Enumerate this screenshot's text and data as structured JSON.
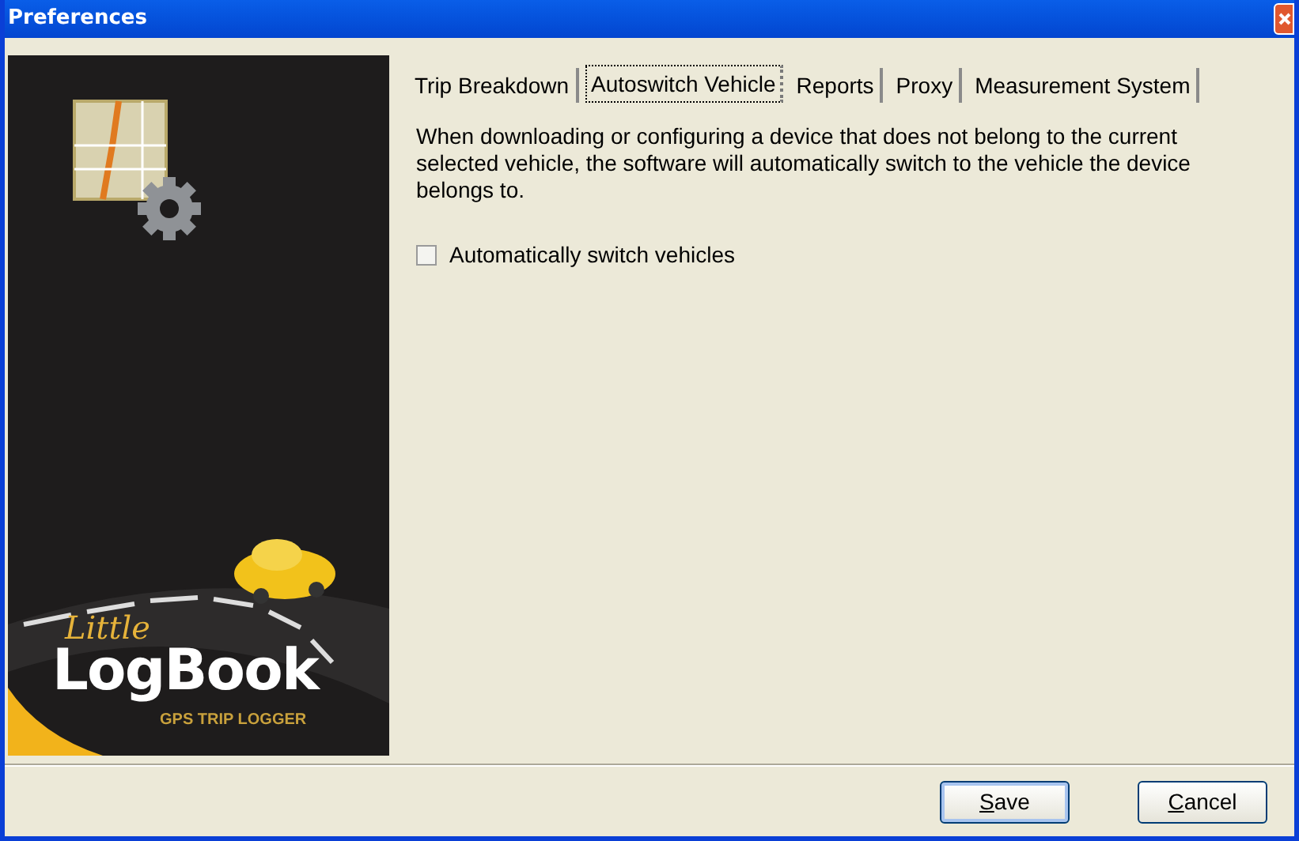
{
  "window": {
    "title": "Preferences"
  },
  "sidebar": {
    "logo_script": "Little",
    "logo_title": "LogBook",
    "logo_subtitle": "GPS TRIP LOGGER"
  },
  "tabs": [
    {
      "label": "Trip Breakdown",
      "selected": false
    },
    {
      "label": "Autoswitch Vehicle",
      "selected": true
    },
    {
      "label": "Reports",
      "selected": false
    },
    {
      "label": "Proxy",
      "selected": false
    },
    {
      "label": "Measurement System",
      "selected": false
    }
  ],
  "description": "When downloading or configuring a device that does not belong to the current selected vehicle, the software will automatically switch to the vehicle the device belongs to.",
  "checkbox": {
    "label": "Automatically switch vehicles",
    "checked": false
  },
  "buttons": [
    {
      "label": "Save",
      "default": true
    },
    {
      "label": "Cancel",
      "default": false
    }
  ]
}
